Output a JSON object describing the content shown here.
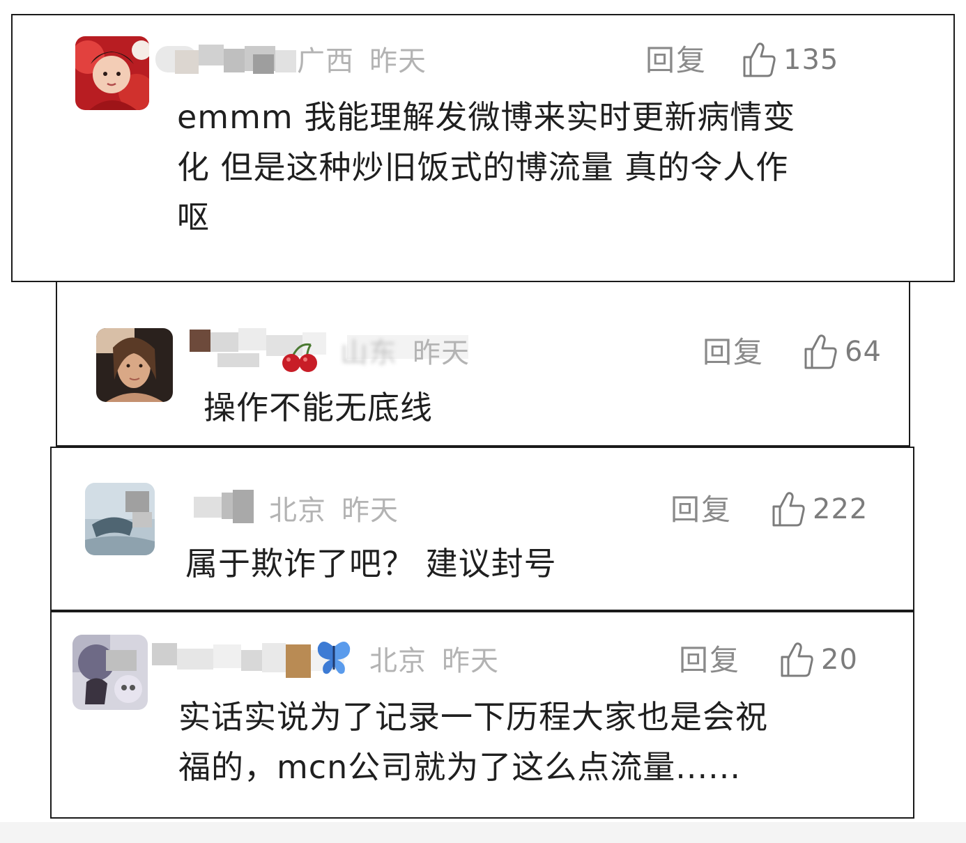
{
  "comments": [
    {
      "location": "广西",
      "time": "昨天",
      "reply_label": "回复",
      "like_count": "135",
      "text_lines": [
        "emmm 我能理解发微博来实时更新病情变",
        "化 但是这种炒旧饭式的博流量 真的令人作",
        "呕"
      ]
    },
    {
      "location": "山东",
      "time": "昨天",
      "reply_label": "回复",
      "like_count": "64",
      "text_lines": [
        "操作不能无底线"
      ]
    },
    {
      "location": "北京",
      "time": "昨天",
      "reply_label": "回复",
      "like_count": "222",
      "text_lines": [
        "属于欺诈了吧？ 建议封号"
      ]
    },
    {
      "location": "北京",
      "time": "昨天",
      "reply_label": "回复",
      "like_count": "20",
      "text_lines": [
        "实话实说为了记录一下历程大家也是会祝",
        "福的，mcn公司就为了这么点流量......"
      ]
    }
  ],
  "icons": {
    "like": "thumbs-up-icon",
    "name_emoji_2": "cherries",
    "name_emoji_4": "butterfly"
  },
  "colors": {
    "meta_gray": "#b3b3b3",
    "action_gray": "#8a8a8a",
    "text": "#1f1f1f",
    "border": "#1a1a1a"
  }
}
